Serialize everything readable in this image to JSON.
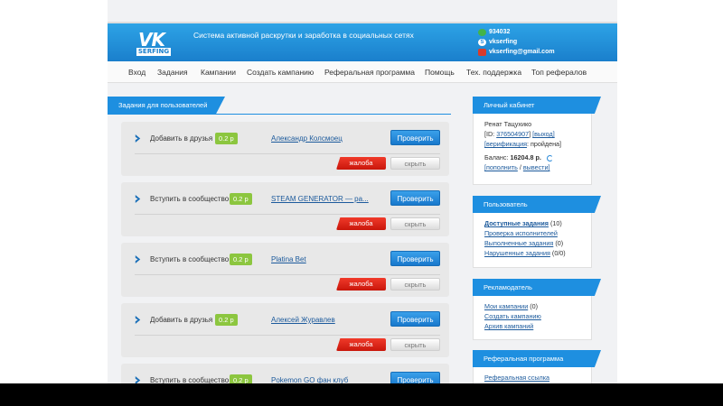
{
  "header": {
    "logo_top": "VK",
    "logo_bottom": "SERFING",
    "tagline": "Система активной раскрутки и заработка в социальных сетях",
    "contacts": [
      {
        "icon": "icq-icon",
        "text": "934032"
      },
      {
        "icon": "skype-icon",
        "text": "vkserfing"
      },
      {
        "icon": "mail-icon",
        "text": "vkserfing@gmail.com"
      }
    ]
  },
  "nav": {
    "items": [
      "Вход",
      "Задания",
      "Кампании",
      "Создать кампанию",
      "Реферальная программа",
      "Помощь",
      "Тех. поддержка",
      "Топ рефералов"
    ]
  },
  "tasks_section": {
    "title": "Задания для пользователей",
    "check_label": "Проверить",
    "complaint_label": "жалоба",
    "hide_label": "скрыть",
    "items": [
      {
        "title": "Добавить в друзья",
        "reward": "0.2 р",
        "target": "Александр Колсмоец"
      },
      {
        "title": "Вступить в сообщество",
        "reward": "0.2 р",
        "target": "STEAM GENERATOR — pa..."
      },
      {
        "title": "Вступить в сообщество",
        "reward": "0.2 р",
        "target": "Platina Bet"
      },
      {
        "title": "Добавить в друзья",
        "reward": "0.2 р",
        "target": "Алексей Журавлев"
      },
      {
        "title": "Вступить в сообщество",
        "reward": "0.2 р",
        "target": "Pokemon GO фан клуб"
      }
    ]
  },
  "account": {
    "title": "Личный кабинет",
    "name": "Ренат Тацухико",
    "id_label": "[ID:",
    "id_value": "376504907",
    "id_close": "]",
    "exit_link": "[выход]",
    "verification_link": "[верификация",
    "verification_status": ": пройдена]",
    "balance_label": "Баланс:",
    "balance_value": "16204.8 р.",
    "topup_link": "[пополнить",
    "slash": " / ",
    "withdraw_link": "вывести]"
  },
  "user_panel": {
    "title": "Пользователь",
    "available_tasks": "Доступные задания",
    "available_count": "(10)",
    "check_performers": "Проверка исполнителей",
    "completed_tasks": "Выполненные задания",
    "completed_count": "(0)",
    "violations": "Нарушенные задания",
    "violations_count": "(0/0)"
  },
  "advertiser_panel": {
    "title": "Рекламодатель",
    "my_campaigns": "Мои кампании",
    "my_campaigns_count": "(0)",
    "create_campaign": "Создать кампанию",
    "archive": "Архив кампаний"
  },
  "referral_panel": {
    "title": "Реферальная программа",
    "referral_link": "Реферальная ссылка"
  },
  "colors": {
    "header_blue": "#1e8fe0",
    "reward_green": "#8cc63f",
    "complaint_red": "#e0261a",
    "link_blue": "#1c5a9c"
  }
}
